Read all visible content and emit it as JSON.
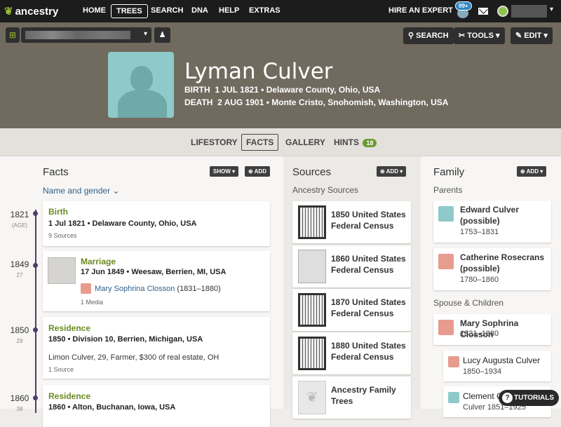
{
  "topnav": {
    "logo": "ancestry",
    "items": [
      "HOME",
      "TREES",
      "SEARCH",
      "DNA",
      "HELP",
      "EXTRAS"
    ],
    "hire_expert": "HIRE AN EXPERT",
    "notifications_badge": "99+"
  },
  "header": {
    "search": "SEARCH",
    "tools": "TOOLS",
    "edit": "EDIT",
    "name": "Lyman Culver",
    "birth_label": "BIRTH",
    "birth_value": "1 JUL 1821 • Delaware County, Ohio, USA",
    "death_label": "DEATH",
    "death_value": "2 AUG 1901 • Monte Cristo, Snohomish, Washington, USA"
  },
  "tabs": {
    "lifestory": "LIFESTORY",
    "facts": "FACTS",
    "gallery": "GALLERY",
    "hints": "HINTS",
    "hints_count": "18"
  },
  "facts": {
    "title": "Facts",
    "show": "SHOW",
    "add": "ADD",
    "name_gender": "Name and gender",
    "items": [
      {
        "year": "1821",
        "age": "(AGE)",
        "title": "Birth",
        "detail": "1 Jul 1821 • Delaware County, Ohio, USA",
        "source": "9 Sources"
      },
      {
        "year": "1849",
        "age": "27",
        "title": "Marriage",
        "detail": "17 Jun 1849 • Weesaw, Berrien, MI, USA",
        "spouse": "Mary Sophrina Closson",
        "spouse_dates": "(1831–1880)",
        "source": "1 Media"
      },
      {
        "year": "1850",
        "age": "29",
        "title": "Residence",
        "detail": "1850 • Division 10, Berrien, Michigan, USA",
        "note": "Limon Culver, 29, Farmer, $300 of real estate, OH",
        "source": "1 Source"
      },
      {
        "year": "1860",
        "age": "38",
        "title": "Residence",
        "detail": "1860 • Alton, Buchanan, Iowa, USA"
      }
    ]
  },
  "sources": {
    "title": "Sources",
    "add": "ADD",
    "subtitle": "Ancestry Sources",
    "items": [
      {
        "line1": "1850 United States",
        "line2": "Federal Census"
      },
      {
        "line1": "1860 United States",
        "line2": "Federal Census"
      },
      {
        "line1": "1870 United States",
        "line2": "Federal Census"
      },
      {
        "line1": "1880 United States",
        "line2": "Federal Census"
      },
      {
        "line1": "Ancestry Family",
        "line2": "Trees"
      }
    ]
  },
  "family": {
    "title": "Family",
    "add": "ADD",
    "parents_label": "Parents",
    "spouse_label": "Spouse & Children",
    "parents": [
      {
        "name1": "Edward Culver",
        "name2": "(possible)",
        "dates": "1753–1831"
      },
      {
        "name1": "Catherine Rosecrans",
        "name2": "(possible)",
        "dates": "1780–1860"
      }
    ],
    "spouse": {
      "name": "Mary Sophrina Closson",
      "dates": "1831–1880"
    },
    "children": [
      {
        "name": "Lucy Augusta Culver",
        "dates": "1850–1934"
      },
      {
        "name": "Clement C",
        "dates": "Culver 1851–1925"
      }
    ]
  },
  "tutorials": "TUTORIALS",
  "colors": {
    "male": "#8ecac9",
    "female": "#e89b8f",
    "accent": "#6a8a1f",
    "link": "#2f5f8a"
  }
}
